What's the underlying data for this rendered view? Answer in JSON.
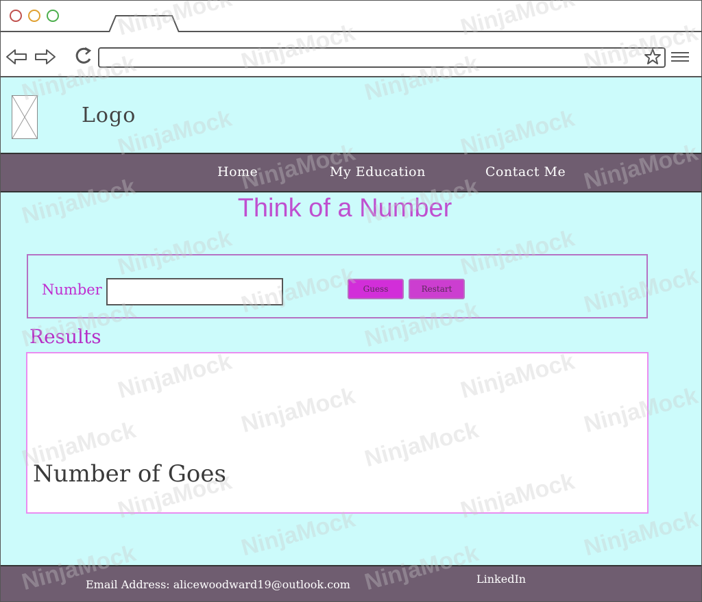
{
  "browser": {
    "icons": {
      "back": "back-arrow-icon",
      "forward": "forward-arrow-icon",
      "reload": "reload-icon",
      "bookmark": "star-icon",
      "menu": "hamburger-menu-icon"
    },
    "address_value": ""
  },
  "header": {
    "logo_text": "Logo"
  },
  "nav": {
    "items": [
      {
        "label": "Home"
      },
      {
        "label": "My Education"
      },
      {
        "label": "Contact Me"
      }
    ]
  },
  "main": {
    "title": "Think of a Number",
    "number_label": "Number",
    "number_value": "",
    "guess_label": "Guess",
    "restart_label": "Restart",
    "results_title": "Results",
    "goes_label": "Number of Goes"
  },
  "footer": {
    "email": "Email Address: alicewoodward19@outlook.com",
    "linkedin": "LinkedIn"
  },
  "watermark": {
    "text": "NinjaMock"
  },
  "colors": {
    "page_bg": "#ccfbfb",
    "nav_bg": "#6f5d70",
    "accent": "#c02ecf",
    "title": "#bf4fcf"
  }
}
